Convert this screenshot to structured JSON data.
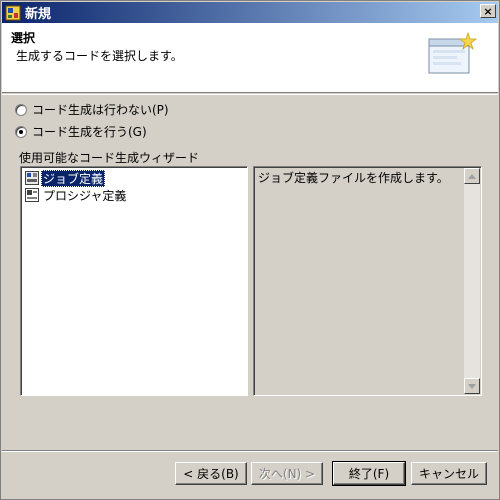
{
  "window": {
    "title": "新規",
    "close_label": "×"
  },
  "banner": {
    "title": "選択",
    "description": "生成するコードを選択します。"
  },
  "options": [
    {
      "label": "コード生成は行わない(P)",
      "selected": false
    },
    {
      "label": "コード生成を行う(G)",
      "selected": true
    }
  ],
  "wizard_group_label": "使用可能なコード生成ウィザード",
  "wizards": [
    {
      "label": "ジョブ定義",
      "icon": "job-definition-icon",
      "selected": true
    },
    {
      "label": "プロシジャ定義",
      "icon": "procedure-definition-icon",
      "selected": false
    }
  ],
  "description_text": "ジョブ定義ファイルを作成します。",
  "buttons": {
    "back": "< 戻る(B)",
    "next": "次へ(N) >",
    "finish": "終了(F)",
    "cancel": "キャンセル"
  },
  "colors": {
    "titlebar_start": "#0a246a",
    "titlebar_end": "#a6caf0",
    "selection": "#0a246a",
    "face": "#d4d0c8"
  }
}
